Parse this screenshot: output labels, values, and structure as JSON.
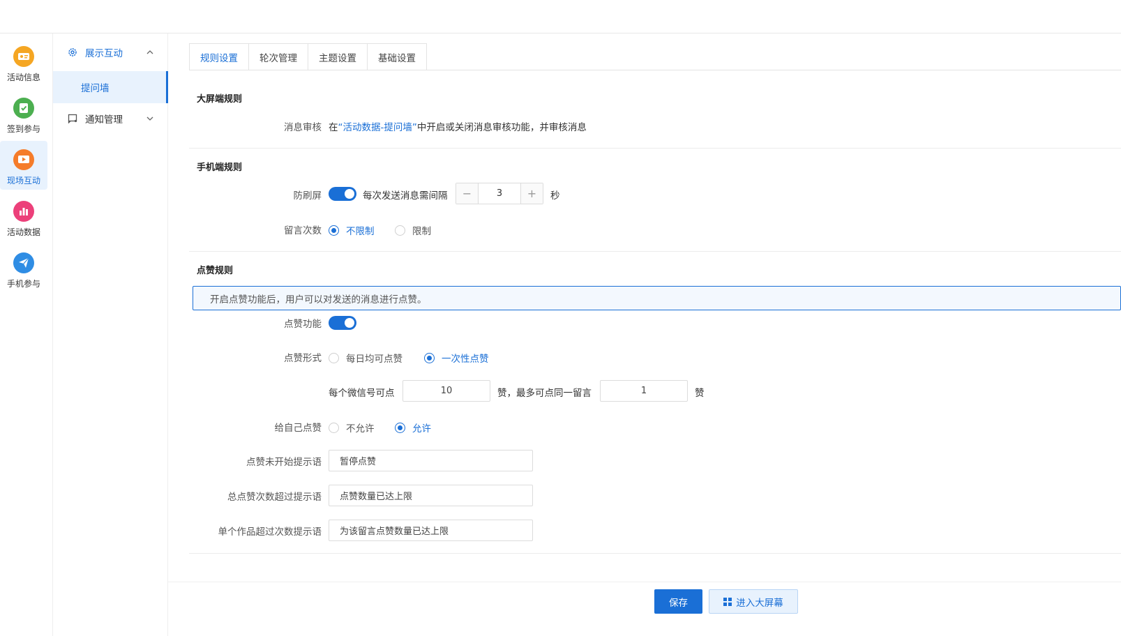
{
  "rail": {
    "items": [
      {
        "label": "活动信息",
        "icon": "ticket-icon",
        "color": "#f5a623"
      },
      {
        "label": "签到参与",
        "icon": "checkin-icon",
        "color": "#4caf50"
      },
      {
        "label": "现场互动",
        "icon": "play-icon",
        "color": "#f57c2a"
      },
      {
        "label": "活动数据",
        "icon": "bar-chart-icon",
        "color": "#ec407a"
      },
      {
        "label": "手机参与",
        "icon": "paper-plane-icon",
        "color": "#2f8de4"
      }
    ]
  },
  "submenu": {
    "group1": {
      "label": "展示互动"
    },
    "sub_item": {
      "label": "提问墙"
    },
    "group2": {
      "label": "通知管理"
    }
  },
  "tabs": [
    {
      "label": "规则设置"
    },
    {
      "label": "轮次管理"
    },
    {
      "label": "主题设置"
    },
    {
      "label": "基础设置"
    }
  ],
  "big_screen": {
    "title": "大屏端规则",
    "review_label": "消息审核",
    "review_text_before": "在",
    "review_link": "“活动数据-提问墙”",
    "review_text_after": "中开启或关闭消息审核功能，并审核消息"
  },
  "mobile": {
    "title": "手机端规则",
    "anti_spam_label": "防刷屏",
    "interval_text": "每次发送消息需间隔",
    "interval_value": "3",
    "interval_minus": "−",
    "interval_plus": "+",
    "interval_unit": "秒",
    "message_count_label": "留言次数",
    "option_unlimited": "不限制",
    "option_limited": "限制"
  },
  "likes": {
    "title": "点赞规则",
    "notice": "开启点赞功能后，用户可以对发送的消息进行点赞。",
    "enable_label": "点赞功能",
    "mode_label": "点赞形式",
    "mode_daily": "每日均可点赞",
    "mode_once": "一次性点赞",
    "per_wechat_text": "每个微信号可点",
    "per_wechat_value": "10",
    "max_same_text": "赞，最多可点同一留言",
    "max_same_value": "1",
    "max_same_unit": "赞",
    "self_like_label": "给自己点赞",
    "self_disallow": "不允许",
    "self_allow": "允许",
    "not_started_label": "点赞未开始提示语",
    "not_started_value": "暂停点赞",
    "total_exceeded_label": "总点赞次数超过提示语",
    "total_exceeded_value": "点赞数量已达上限",
    "single_exceeded_label": "单个作品超过次数提示语",
    "single_exceeded_value": "为该留言点赞数量已达上限"
  },
  "footer": {
    "save": "保存",
    "enter_screen": "进入大屏幕"
  },
  "colors": {
    "accent": "#1a6fd6"
  }
}
